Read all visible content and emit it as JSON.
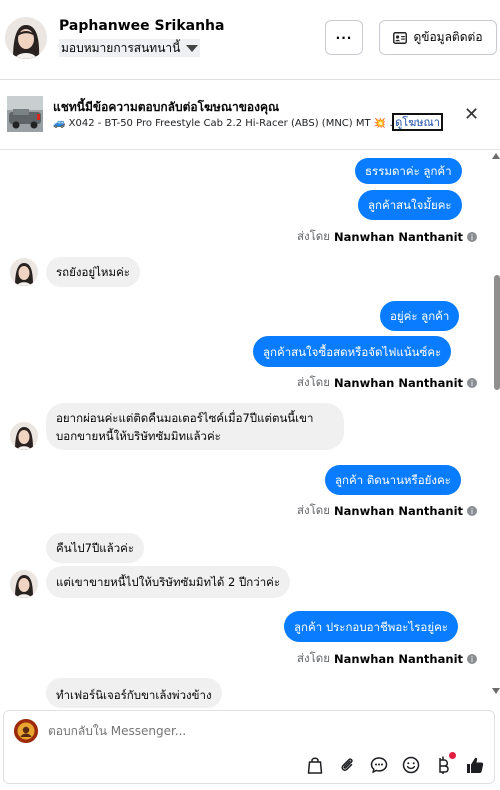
{
  "header": {
    "contact_name": "Paphanwee Srikanha",
    "assign_label": "มอบหมายการสนทนานี้",
    "more_label": "···",
    "contact_info_label": "ดูข้อมูลติดต่อ"
  },
  "ad_banner": {
    "title": "แชทนี้มีข้อความตอบกลับต่อโฆษณาของคุณ",
    "subtitle": "🚙 X042 - BT-50 Pro Freestyle Cab 2.2 Hi-Racer (ABS) (MNC) MT 💥 …",
    "link_label": "ดูโฆษณา",
    "close_label": "✕"
  },
  "messages": {
    "m1": "ธรรมดาค่ะ  ลูกค้า",
    "m2": "ลูกค้าสนใจมั้ยคะ",
    "m3": "รถยังอยู่ไหมค่ะ",
    "m4": "อยู่ค่ะ  ลูกค้า",
    "m5": "ลูกค้าสนใจซื้อสดหรือจัดไฟแน้นซ์คะ",
    "m6": "อยากผ่อนค่ะแต่ติดคืนมอเตอร์ไซค์เมื่อ7ปีแต่ตนนี้เขาบอกขายหนี้ให้บริษัทซัมมิทแล้วค่ะ",
    "m7": "ลูกค้า ติดนานหรือยังคะ",
    "m8": "คืนไป7ปีแล้วค่ะ",
    "m9": "แต่เขาขายหนี้ไปให้บริษัทซัมมิทได้ 2 ปีกว่าค่ะ",
    "m10": "ลูกค้า ประกอบอาชีพอะไรอยู่คะ",
    "m11": "ทำเฟอร์นิเจอร์กับขาเล้งพ่วงข้าง"
  },
  "sent_by": {
    "prefix": "ส่งโดย",
    "agent": "Nanwhan Nanthanit"
  },
  "composer": {
    "placeholder": "ตอบกลับใน Messenger..."
  },
  "colors": {
    "outgoing_bubble": "#0a7cff",
    "incoming_bubble": "#f0f0f0"
  }
}
